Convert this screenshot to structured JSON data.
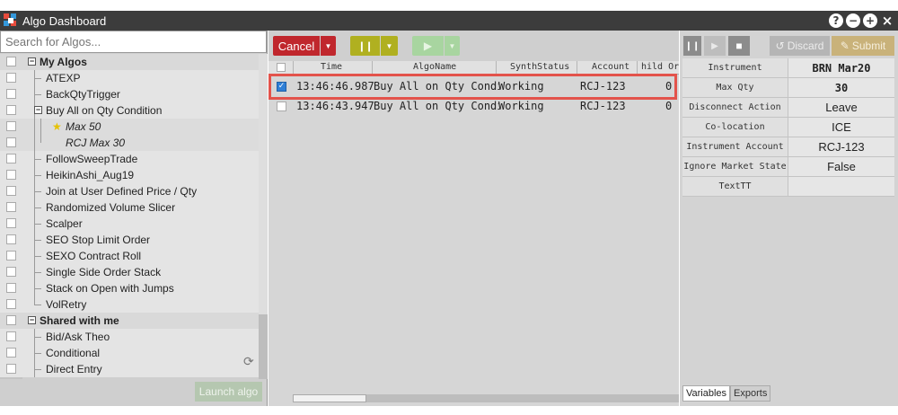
{
  "window": {
    "title": "Algo Dashboard",
    "controls": [
      "?",
      "−",
      "+",
      "×"
    ]
  },
  "left": {
    "search_placeholder": "Search for Algos...",
    "groups": [
      {
        "label": "My Algos",
        "toggle": "−"
      },
      {
        "label": "Shared with me",
        "toggle": "−"
      }
    ],
    "my_algos": [
      "ATEXP",
      "BackQtyTrigger",
      "Buy All on Qty Condition",
      "Max 50",
      "RCJ Max 30",
      "FollowSweepTrade",
      "HeikinAshi_Aug19",
      "Join at User Defined Price / Qty",
      "Randomized Volume Slicer",
      "Scalper",
      "SEO Stop Limit Order",
      "SEXO Contract Roll",
      "Single Side Order Stack",
      "Stack on Open with Jumps",
      "VolRetry"
    ],
    "shared": [
      "Bid/Ask Theo",
      "Conditional",
      "Direct Entry"
    ],
    "launch_label": "Launch algo"
  },
  "toolbar": {
    "cancel_label": "Cancel"
  },
  "grid": {
    "columns": [
      "Time",
      "AlgoName",
      "SynthStatus",
      "Account",
      "hild Ord"
    ],
    "rows": [
      {
        "time": "13:46:46.987",
        "algo": "Buy All on Qty Condi",
        "status": "Working",
        "account": "RCJ-123",
        "child": "0",
        "checked": true
      },
      {
        "time": "13:46:43.947",
        "algo": "Buy All on Qty Condi",
        "status": "Working",
        "account": "RCJ-123",
        "child": "0",
        "checked": false
      }
    ]
  },
  "right": {
    "discard_label": "Discard",
    "submit_label": "Submit",
    "properties": [
      {
        "key": "Instrument",
        "value": "BRN Mar20"
      },
      {
        "key": "Max Qty",
        "value": "30"
      },
      {
        "key": "Disconnect Action",
        "value": "Leave"
      },
      {
        "key": "Co-location",
        "value": "ICE"
      },
      {
        "key": "Instrument Account",
        "value": "RCJ-123"
      },
      {
        "key": "Ignore Market State",
        "value": "False"
      },
      {
        "key": "TextTT",
        "value": ""
      }
    ],
    "tabs": [
      "Variables",
      "Exports"
    ]
  },
  "colors": {
    "cancel": "#c0272d",
    "pause": "#b0b020",
    "play": "#a8d5a0",
    "highlight": "#e3534b",
    "titlebar": "#3c3c3c"
  }
}
